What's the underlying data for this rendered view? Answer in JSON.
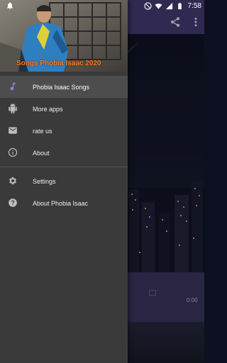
{
  "status_bar": {
    "time": "7:58",
    "icons": [
      "notification-bell-icon",
      "do-not-disturb-icon",
      "wifi-icon",
      "signal-icon",
      "battery-icon"
    ]
  },
  "drawer": {
    "header_title": "Songs Phobia Isaac 2020",
    "primary_items": [
      {
        "label": "Phobia Isaac Songs",
        "icon": "music-note-icon",
        "active": true
      },
      {
        "label": "More apps",
        "icon": "android-icon",
        "active": false
      },
      {
        "label": "rate us",
        "icon": "mail-icon",
        "active": false
      },
      {
        "label": "About",
        "icon": "info-icon",
        "active": false
      }
    ],
    "secondary_items": [
      {
        "label": "Settings",
        "icon": "gear-icon",
        "active": false
      },
      {
        "label": "About Phobia Isaac",
        "icon": "help-icon",
        "active": false
      }
    ]
  },
  "background_app": {
    "player_time": "0:00"
  },
  "colors": {
    "toolbar": "#4a3f7d",
    "drawer_bg": "#3a3a3a",
    "accent_icon": "#9a7ed8",
    "header_title": "#ff7a1a"
  }
}
